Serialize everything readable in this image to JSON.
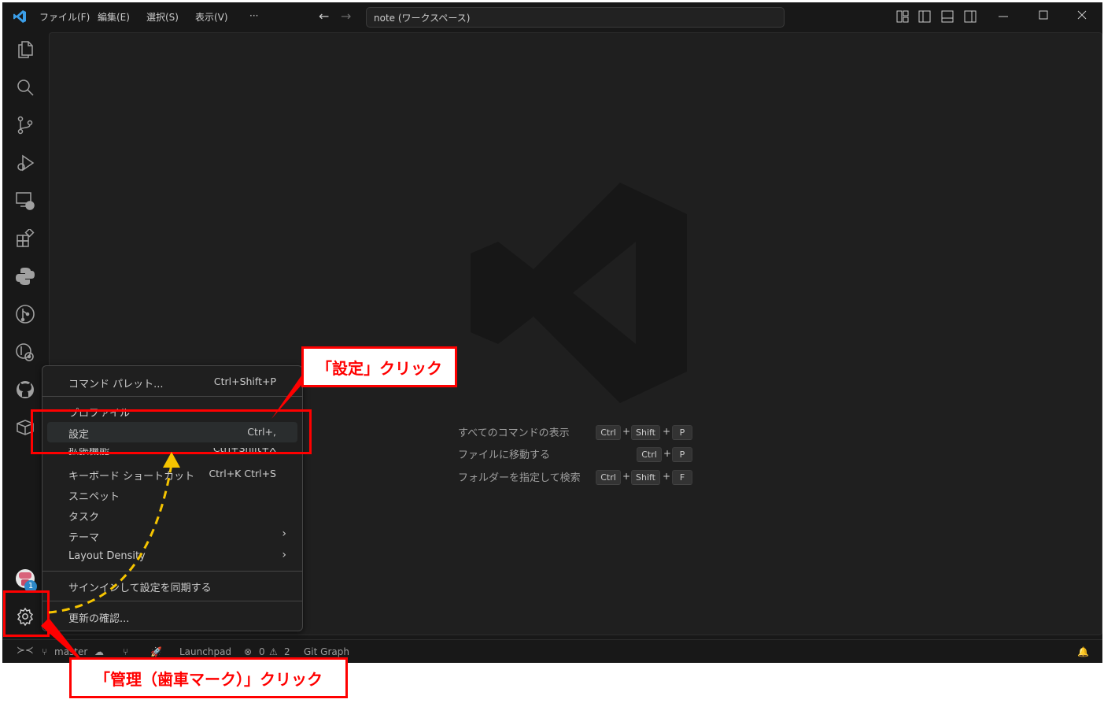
{
  "titlebar": {
    "menus": [
      "ファイル(F)",
      "編集(E)",
      "選択(S)",
      "表示(V)",
      "···"
    ],
    "search_text": "note (ワークスペース)"
  },
  "activity_bar": {
    "icons": [
      "explorer-icon",
      "search-icon",
      "source-control-icon",
      "run-debug-icon",
      "remote-explorer-icon",
      "extensions-icon",
      "python-icon",
      "gitlens-icon",
      "git-graph-icon",
      "github-icon",
      "package-icon"
    ],
    "badge": "1"
  },
  "welcome_hints": [
    {
      "label": "すべてのコマンドの表示",
      "keys": [
        "Ctrl",
        "Shift",
        "P"
      ]
    },
    {
      "label": "ファイルに移動する",
      "keys": [
        "Ctrl",
        "P"
      ]
    },
    {
      "label": "フォルダーを指定して検索",
      "keys": [
        "Ctrl",
        "Shift",
        "F"
      ]
    }
  ],
  "manage_menu": {
    "command_palette": {
      "label": "コマンド パレット...",
      "key": "Ctrl+Shift+P"
    },
    "profile": {
      "label": "プロファイル"
    },
    "settings": {
      "label": "設定",
      "key": "Ctrl+,"
    },
    "extensions": {
      "label": "拡張機能",
      "key": "Ctrl+Shift+X"
    },
    "keyboard_shortcuts": {
      "label": "キーボード ショートカット",
      "key": "Ctrl+K Ctrl+S"
    },
    "snippets": {
      "label": "スニペット"
    },
    "tasks": {
      "label": "タスク"
    },
    "theme": {
      "label": "テーマ"
    },
    "layout_density": {
      "label": "Layout Density"
    },
    "sign_in_sync": {
      "label": "サインインして設定を同期する"
    },
    "check_updates": {
      "label": "更新の確認..."
    }
  },
  "status_bar": {
    "branch": "master",
    "launchpad": "Launchpad",
    "errors": "0",
    "warnings": "2",
    "git_graph": "Git Graph"
  },
  "annotations": {
    "settings_click": "「設定」クリック",
    "manage_click": "「管理（歯車マーク）」クリック",
    "color": "#ff0000",
    "arrow_color": "#f5c400"
  }
}
